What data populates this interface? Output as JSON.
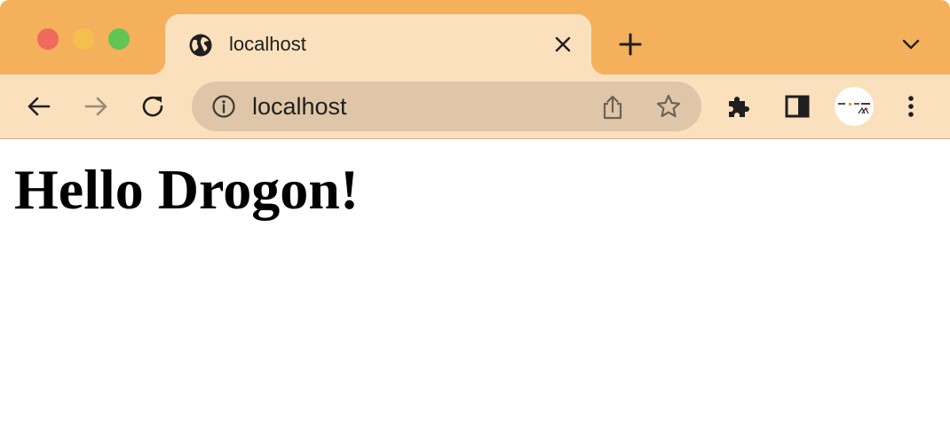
{
  "browser": {
    "tab": {
      "title": "localhost",
      "favicon": "globe-icon"
    },
    "address_bar": {
      "url": "localhost",
      "security_icon": "info-icon"
    },
    "toolbar_icons": [
      "back-arrow-icon",
      "forward-arrow-icon",
      "reload-icon",
      "share-icon",
      "star-icon",
      "puzzle-icon",
      "side-panel-icon",
      "avatar",
      "kebab-menu-icon"
    ],
    "colors": {
      "tab_strip": "#f4b05a",
      "toolbar": "#fae0bc",
      "omnibox": "#dfc6a8"
    }
  },
  "page": {
    "heading": "Hello Drogon!"
  }
}
